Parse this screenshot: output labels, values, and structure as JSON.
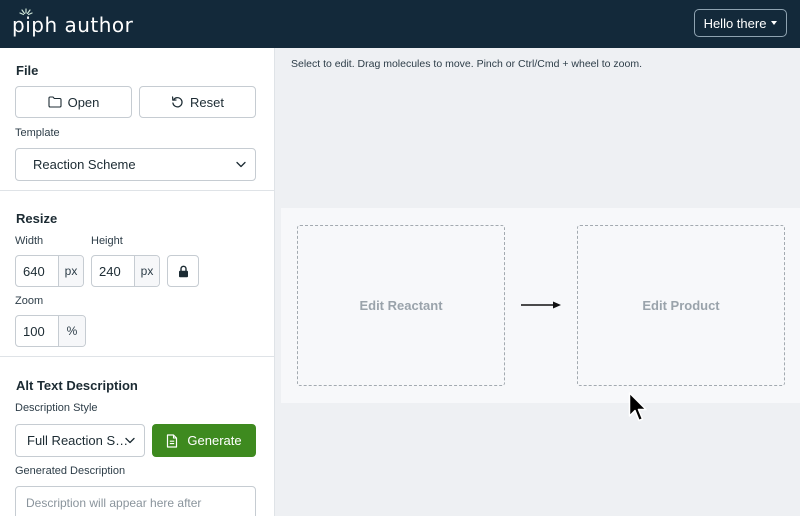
{
  "app": {
    "logo": "piph author",
    "user_menu": "Hello there"
  },
  "sidebar": {
    "file": {
      "title": "File",
      "open_label": "Open",
      "reset_label": "Reset",
      "template_label": "Template",
      "template_value": "Reaction Scheme"
    },
    "resize": {
      "title": "Resize",
      "width_label": "Width",
      "width_value": "640",
      "width_unit": "px",
      "height_label": "Height",
      "height_value": "240",
      "height_unit": "px",
      "zoom_label": "Zoom",
      "zoom_value": "100",
      "zoom_unit": "%"
    },
    "alt_text": {
      "title": "Alt Text Description",
      "style_label": "Description Style",
      "style_value": "Full Reaction S…",
      "generate_label": "Generate",
      "generated_label": "Generated Description",
      "placeholder": "Description will appear here after"
    }
  },
  "main": {
    "hint": "Select to edit. Drag molecules to move. Pinch or Ctrl/Cmd + wheel to zoom.",
    "reactant_label": "Edit Reactant",
    "product_label": "Edit Product"
  },
  "colors": {
    "topbar": "#13293a",
    "accent_green": "#3e8a1f"
  }
}
